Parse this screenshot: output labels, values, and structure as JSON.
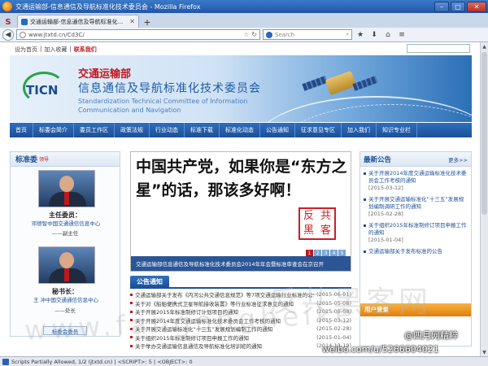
{
  "window": {
    "title": "交通运输部-信息通信及导航标准化技术委员会 - Mozilla Firefox",
    "min": "–",
    "max": "□",
    "close": "✕"
  },
  "tabs": [
    {
      "label": "交通运输部-信息通信及导航标准化..."
    }
  ],
  "toolbar": {
    "url": "www.jtxtd.cn/Cd3C/",
    "search_placeholder": "Search"
  },
  "site": {
    "toplinks": [
      "设为首页",
      "加入收藏",
      "联系我们"
    ],
    "logo_text": "TICN",
    "org_line1": "交通运输部",
    "org_line2": "信息通信及导航标准化技术委员会",
    "org_en1": "Standardization Technical Committee of Information",
    "org_en2": "Communication and Navigation"
  },
  "nav": [
    "首页",
    "标委会简介",
    "委员工作区",
    "政策法规",
    "行业动态",
    "标准下载",
    "标准化动态",
    "公告通知",
    "征求意见专区",
    "加入我们",
    "知识专业栏"
  ],
  "sidebar": {
    "title": "标准委",
    "title_sub": "领导",
    "leaders": [
      {
        "role": "主任委员：",
        "desc": "邓德智中国交通通信信息中心",
        "rank": "——副主任"
      },
      {
        "role": "秘书长：",
        "desc": "王 冲中国交通通信信息中心",
        "rank": "——处长"
      }
    ],
    "more_label": "标委会委员"
  },
  "banner": {
    "slogan": "中国共产党，如果你是“东方之星”的话，那该多好啊！",
    "seal": [
      "反",
      "共",
      "黑",
      "客"
    ],
    "caption": "交通运输部信息通信及导航标准化技术委员会2014年年会暨标准审查会在京召开",
    "pages": [
      "1",
      "2",
      "3",
      "4",
      "5"
    ],
    "active_page": "1"
  },
  "notices": {
    "tab_label": "公告通知",
    "items": [
      {
        "title": "交通运输部关于发布《内河公共交通信息规范》等7项交通运输行业标准的公告",
        "date": "(2015-06-01)"
      },
      {
        "title": "关于对《船舶便携式卫星导航接收装置》等行业标准征求意见的通知",
        "date": "(2015-05-08)"
      },
      {
        "title": "关于开展2015年标准制修订计划项目的通知",
        "date": "(2015-05-08)"
      },
      {
        "title": "关于开展2014年度交通运输标准化技术委员会工作考核的通知",
        "date": "(2015-03-12)"
      },
      {
        "title": "关于开展交通运输标准化“十三五”发展规划编制工作的通知",
        "date": "(2015-02-28)"
      },
      {
        "title": "关于组织2015年标准制修订项目申报工作的通知",
        "date": "(2015-01-04)"
      },
      {
        "title": "关于举办交通运输信息通信及导航标准化培训班的通知",
        "date": "(2014-12-19)"
      }
    ]
  },
  "rightcol": {
    "title": "最新公告",
    "more": "更多>>",
    "items": [
      {
        "text": "关于开展2014年度交通运输标准化技术委员会工作考核的通知",
        "date": "[2015-03-12]"
      },
      {
        "text": "关于开展交通运输标准化“十三五”发展规划编制调研工作的通知",
        "date": "[2015-02-28]"
      },
      {
        "text": "关于组织2015年标准制修订项目申报工作的通知",
        "date": "[2015-01-04]"
      },
      {
        "text": "交通运输部关于发布标准的公告",
        "date": ""
      }
    ],
    "user_login": "用户登录"
  },
  "watermarks": {
    "cn": "反共黑客网",
    "url": "www.fangongheike",
    "weibo": "weibo.com/u/5266604021",
    "weibo_name": "@四月网精粹"
  },
  "statusbar": {
    "text": "Scripts Partially Allowed, 1/2 (jtxtd.cn) | <SCRIPT>: 5 | <OBJECT>: 0"
  },
  "colors": {
    "brand_blue": "#1b4f98",
    "brand_red": "#c0171f",
    "titlebar": "#2156a8"
  }
}
